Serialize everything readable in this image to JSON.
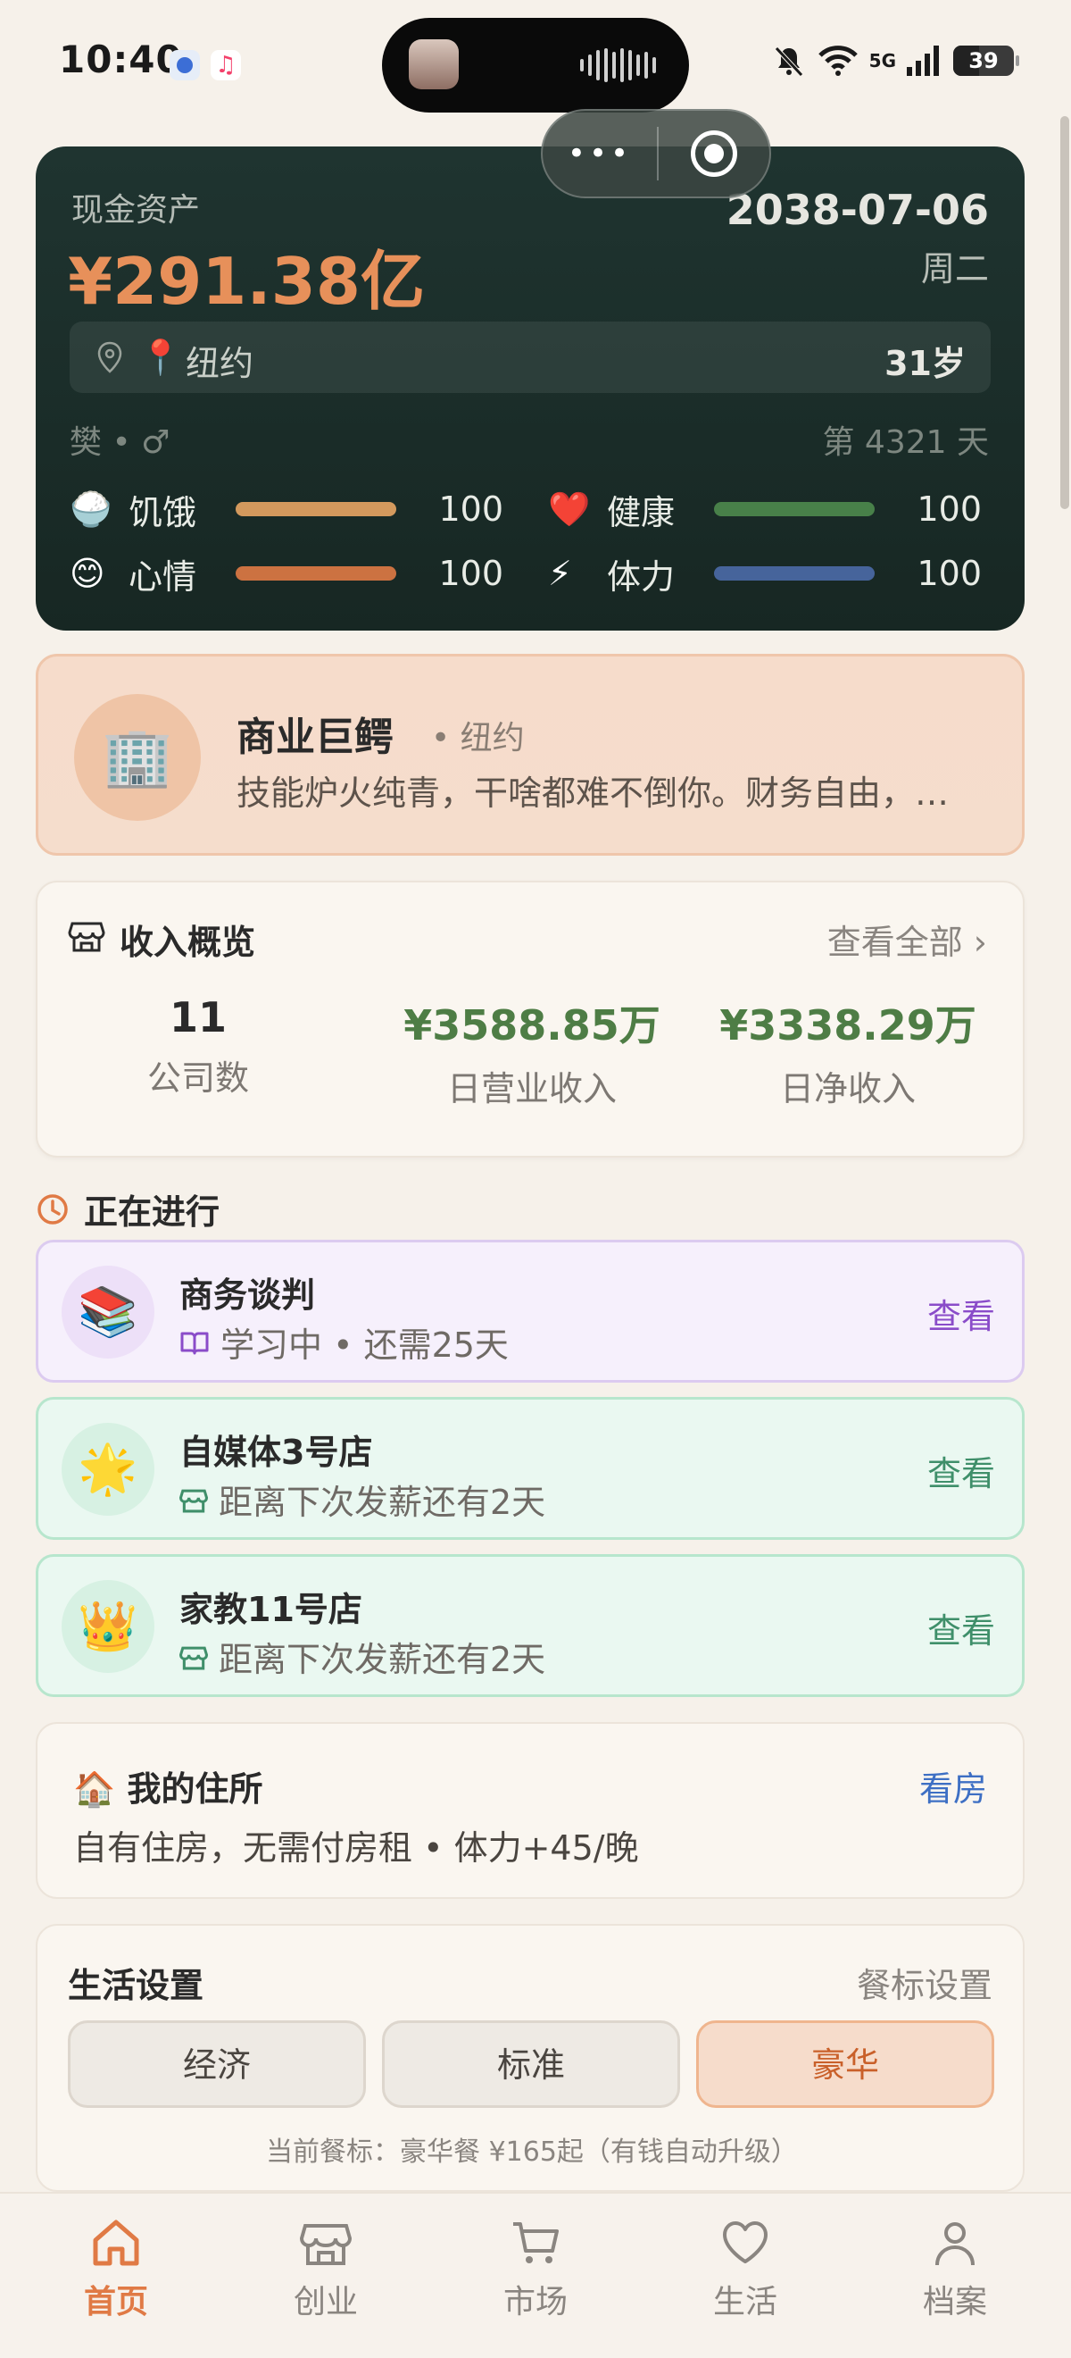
{
  "status_bar": {
    "time": "10:40",
    "battery": "39",
    "network": "5G"
  },
  "capsule": {
    "more": "•••"
  },
  "asset_card": {
    "label": "现金资产",
    "value": "¥291.38亿",
    "date": "2038-07-06",
    "weekday": "周二",
    "location_pin": "📍",
    "location": "纽约",
    "age": "31岁",
    "name_line": "樊 • ♂",
    "day_count": "第 4321 天",
    "stats": [
      {
        "emoji": "🍚",
        "label": "饥饿",
        "value": 100,
        "color": "#e8a564"
      },
      {
        "emoji": "❤️",
        "label": "健康",
        "value": 100,
        "color": "#4e8a4e"
      },
      {
        "emoji": "😊",
        "label": "心情",
        "value": 100,
        "color": "#e07a45"
      },
      {
        "emoji": "⚡",
        "label": "体力",
        "value": 100,
        "color": "#4b6aa8"
      }
    ]
  },
  "profession": {
    "icon": "🏢",
    "title": "商业巨鳄",
    "location": "• 纽约",
    "desc": "技能炉火纯青，干啥都难不倒你。财务自由，…"
  },
  "income": {
    "title": "收入概览",
    "view_all": "查看全部 ›",
    "metrics": [
      {
        "value": "11",
        "label": "公司数",
        "color": "#2a2a2a"
      },
      {
        "value": "¥3588.85万",
        "label": "日营业收入",
        "color": "#4e7d45"
      },
      {
        "value": "¥3338.29万",
        "label": "日净收入",
        "color": "#4e7d45"
      }
    ]
  },
  "in_progress": {
    "title": "正在进行",
    "tasks": [
      {
        "icon": "📚",
        "title": "商务谈判",
        "status": "学习中 • 还需25天",
        "action": "查看"
      },
      {
        "icon": "🌟",
        "title": "自媒体3号店",
        "status": "距离下次发薪还有2天",
        "action": "查看"
      },
      {
        "icon": "👑",
        "title": "家教11号店",
        "status": "距离下次发薪还有2天",
        "action": "查看"
      }
    ]
  },
  "residence": {
    "title": "🏠 我的住所",
    "link": "看房",
    "desc": "自有住房，无需付房租 • 体力+45/晚"
  },
  "life_settings": {
    "title": "生活设置",
    "link": "餐标设置",
    "options": [
      "经济",
      "标准",
      "豪华"
    ],
    "selected": "豪华",
    "note": "当前餐标：豪华餐 ¥165起（有钱自动升级）"
  },
  "nav": {
    "items": [
      "首页",
      "创业",
      "市场",
      "生活",
      "档案"
    ],
    "active": "首页",
    "accent": "#e07a45"
  }
}
